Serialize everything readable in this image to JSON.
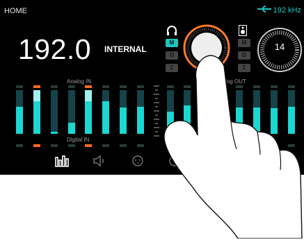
{
  "header": {
    "home_label": "HOME",
    "rate_indicator": "192 kHz",
    "rate_icon": "sync-icon"
  },
  "main": {
    "sample_rate": "192.0",
    "clock_source": "INTERNAL"
  },
  "headphone": {
    "icon": "headphones-icon",
    "modes": [
      {
        "label": "M",
        "active": true
      },
      {
        "label": "D",
        "active": false
      },
      {
        "label": "Σ",
        "active": false
      }
    ]
  },
  "speaker": {
    "icon": "speaker-icon",
    "modes": [
      {
        "label": "M",
        "active": false
      },
      {
        "label": "D",
        "active": false
      },
      {
        "label": "Σ",
        "active": false
      }
    ]
  },
  "main_knob": {
    "value": "14"
  },
  "meters": {
    "analog_in_label": "Analog IN",
    "digital_in_label": "Digital IN",
    "analog_out_label": "log OUT",
    "analog_in_levels": [
      0.62,
      0.95,
      0.05,
      0.25,
      0.92,
      0.75,
      0.6,
      0.62
    ],
    "analog_out_levels": [
      0.5,
      0.65,
      0.05,
      0.2,
      0.6,
      0.6,
      0.58,
      0.62
    ],
    "peak_color": "#ff6a1a",
    "meter_color": "#1ad7d2"
  },
  "tabs": [
    {
      "name": "meters-tab-icon"
    },
    {
      "name": "speaker-volume-tab-icon"
    },
    {
      "name": "routing-tab-icon"
    },
    {
      "name": "settings-tab-icon"
    }
  ],
  "colors": {
    "accent": "#1bc6bd",
    "knob_ring": "#ff7a2a"
  }
}
